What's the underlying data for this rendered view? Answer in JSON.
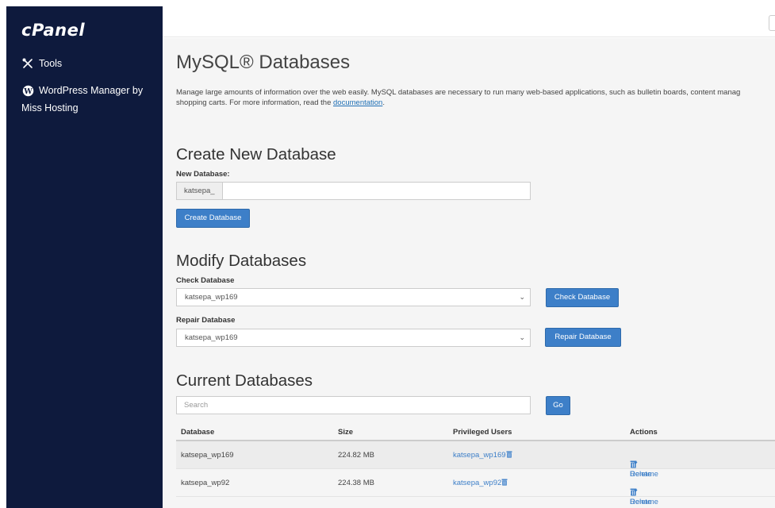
{
  "sidebar": {
    "logo": "cPanel",
    "items": [
      {
        "label": "Tools",
        "icon": "tools-icon"
      },
      {
        "label_line1": "WordPress Manager by",
        "label_line2": "Miss Hosting",
        "icon": "wordpress-icon"
      }
    ]
  },
  "page": {
    "title": "MySQL® Databases",
    "description_line1": "Manage large amounts of information over the web easily. MySQL databases are necessary to run many web-based applications, such as bulletin boards, content manag",
    "description_line2_prefix": "shopping carts. For more information, read the ",
    "description_link": "documentation",
    "description_line2_suffix": "."
  },
  "create": {
    "heading": "Create New Database",
    "label": "New Database:",
    "prefix": "katsepa_",
    "value": "",
    "button": "Create Database"
  },
  "modify": {
    "heading": "Modify Databases",
    "check_label": "Check Database",
    "check_selected": "katsepa_wp169",
    "check_button": "Check Database",
    "repair_label": "Repair Database",
    "repair_selected": "katsepa_wp169",
    "repair_button": "Repair Database"
  },
  "current": {
    "heading": "Current Databases",
    "search_placeholder": "Search",
    "go_button": "Go",
    "columns": [
      "Database",
      "Size",
      "Privileged Users",
      "Actions"
    ],
    "rows": [
      {
        "database": "katsepa_wp169",
        "size": "224.82 MB",
        "user": "katsepa_wp169",
        "rename": "Rename",
        "delete": "Delete"
      },
      {
        "database": "katsepa_wp92",
        "size": "224.38 MB",
        "user": "katsepa_wp92",
        "rename": "Rename",
        "delete": "Delete"
      }
    ]
  },
  "colors": {
    "sidebar_bg": "#0e1a3d",
    "accent": "#3d7fc8",
    "main_bg": "#f5f5f5"
  }
}
